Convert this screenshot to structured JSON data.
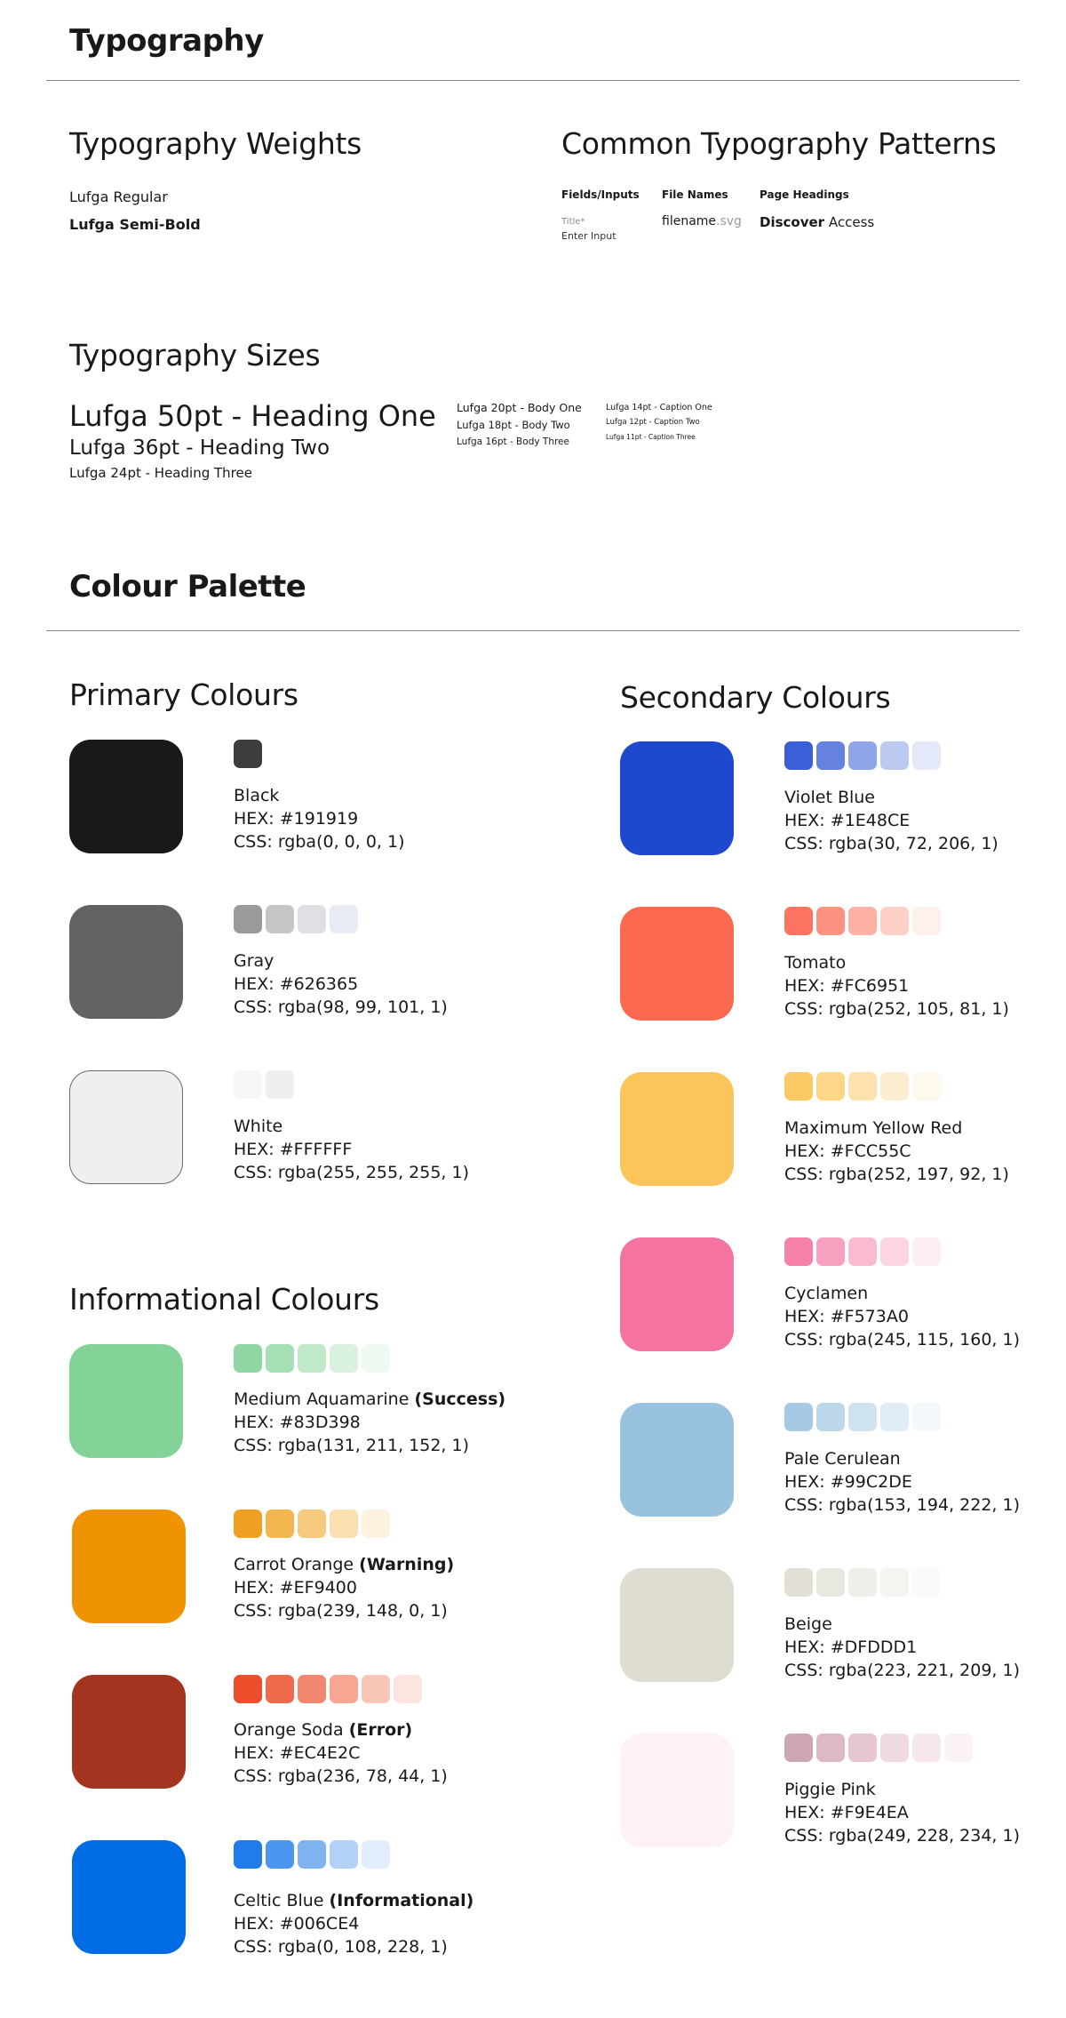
{
  "typography": {
    "title": "Typography",
    "weights": {
      "heading": "Typography Weights",
      "regular": "Lufga Regular",
      "semibold": "Lufga Semi-Bold"
    },
    "patterns": {
      "heading": "Common Typography Patterns",
      "fields": {
        "head": "Fields/Inputs",
        "label": "Title*",
        "input": "Enter Input"
      },
      "files": {
        "head": "File Names",
        "name": "filename",
        "ext": ".svg"
      },
      "headings": {
        "head": "Page Headings",
        "bold": "Discover",
        "rest": " Access"
      }
    },
    "sizes": {
      "heading": "Typography Sizes",
      "h1": "Lufga 50pt - Heading One",
      "h2": "Lufga 36pt - Heading Two",
      "h3": "Lufga 24pt - Heading Three",
      "b1": "Lufga 20pt - Body One",
      "b2": "Lufga 18pt - Body Two",
      "b3": "Lufga 16pt - Body Three",
      "c1": "Lufga 14pt - Caption One",
      "c2": "Lufga 12pt - Caption Two",
      "c3": "Lufga 11pt - Caption Three"
    }
  },
  "palette": {
    "title": "Colour Palette",
    "primary": {
      "heading": "Primary Colours",
      "colors": [
        {
          "name": "Black",
          "hex": "HEX: #191919",
          "css": "CSS: rgba(0, 0, 0, 1)",
          "swatch": "#191919",
          "tints": [
            "#3d3d3d"
          ]
        },
        {
          "name": "Gray",
          "hex": "HEX: #626365",
          "css": "CSS: rgba(98, 99, 101, 1)",
          "swatch": "#626365",
          "tints": [
            "#9a9a9a",
            "#c6c6c8",
            "#dfe0e4",
            "#e8ebf3"
          ]
        },
        {
          "name": "White",
          "hex": "HEX: #FFFFFF",
          "css": "CSS: rgba(255, 255, 255, 1)",
          "swatch": "#efefef",
          "tints": [
            "#f7f7f7",
            "#efefef"
          ]
        }
      ]
    },
    "informational": {
      "heading": "Informational Colours",
      "colors": [
        {
          "name": "Medium Aquamarine",
          "tag": "(Success)",
          "hex": "HEX: #83D398",
          "css": "CSS: rgba(131, 211, 152, 1)",
          "swatch": "#83d398",
          "tints": [
            "#8fd6a2",
            "#a8e0b6",
            "#c0e9ca",
            "#d9f2df",
            "#eef9f1"
          ]
        },
        {
          "name": "Carrot Orange",
          "tag": "(Warning)",
          "hex": "HEX: #EF9400",
          "css": "CSS: rgba(239, 148, 0, 1)",
          "swatch": "#ef9400",
          "tints": [
            "#f0a020",
            "#f3b550",
            "#f7ca80",
            "#fadfb0",
            "#fdf2e0"
          ]
        },
        {
          "name": "Orange Soda",
          "tag": "(Error)",
          "hex": "HEX: #EC4E2C",
          "css": "CSS: rgba(236, 78, 44, 1)",
          "swatch": "#a33420",
          "tints": [
            "#ec4e2c",
            "#ef6a4d",
            "#f28770",
            "#f6a692",
            "#f9c6b8",
            "#fce5de"
          ]
        },
        {
          "name": "Celtic Blue",
          "tag": "(Informational)",
          "hex": "HEX: #006CE4",
          "css": "CSS: rgba(0, 108, 228, 1)",
          "swatch": "#006ce4",
          "tints": [
            "#1f7ce8",
            "#4d96ed",
            "#80b3f2",
            "#b3d1f7",
            "#e3eefc"
          ]
        }
      ]
    },
    "secondary": {
      "heading": "Secondary Colours",
      "colors": [
        {
          "name": "Violet Blue",
          "hex": "HEX: #1E48CE",
          "css": "CSS: rgba(30, 72, 206, 1)",
          "swatch": "#1e48ce",
          "tints": [
            "#3a5fd6",
            "#6582de",
            "#91a6e8",
            "#bcc9f1",
            "#e4e9fa"
          ]
        },
        {
          "name": "Tomato",
          "hex": "HEX: #FC6951",
          "css": "CSS: rgba(252, 105, 81, 1)",
          "swatch": "#fc6951",
          "tints": [
            "#fc7460",
            "#fd9280",
            "#feb0a3",
            "#fed0c7",
            "#fff0ec"
          ]
        },
        {
          "name": "Maximum Yellow Red",
          "hex": "HEX: #FCC55C",
          "css": "CSS: rgba(252, 197, 92, 1)",
          "swatch": "#fcc55c",
          "tints": [
            "#fcc964",
            "#fdd688",
            "#fde2ad",
            "#feeed1",
            "#fff8ec"
          ]
        },
        {
          "name": "Cyclamen",
          "hex": "HEX: #F573A0",
          "css": "CSS: rgba(245, 115, 160, 1)",
          "swatch": "#f573a0",
          "tints": [
            "#f682aa",
            "#f8a0bf",
            "#fabbd1",
            "#fcd5e3",
            "#feeef4"
          ]
        },
        {
          "name": "Pale Cerulean",
          "hex": "HEX: #99C2DE",
          "css": "CSS: rgba(153, 194, 222, 1)",
          "swatch": "#99c2de",
          "tints": [
            "#a6cae3",
            "#bcd7ea",
            "#cfe2f0",
            "#e1edf6",
            "#f3f8fb"
          ]
        },
        {
          "name": "Beige",
          "hex": "HEX: #DFDDD1",
          "css": "CSS: rgba(223, 221, 209, 1)",
          "swatch": "#dfddd1",
          "tints": [
            "#e2e0d6",
            "#e9e8e0",
            "#efeee9",
            "#f5f4f1",
            "#fafaf8"
          ]
        },
        {
          "name": "Piggie Pink",
          "hex": "HEX: #F9E4EA",
          "css": "CSS: rgba(249, 228, 234, 1)",
          "swatch": "#fff2f6",
          "tints": [
            "#cca7b1",
            "#dcb9c3",
            "#e6c7d0",
            "#f0dae1",
            "#f7e7ec",
            "#fbf2f5"
          ]
        }
      ]
    }
  }
}
